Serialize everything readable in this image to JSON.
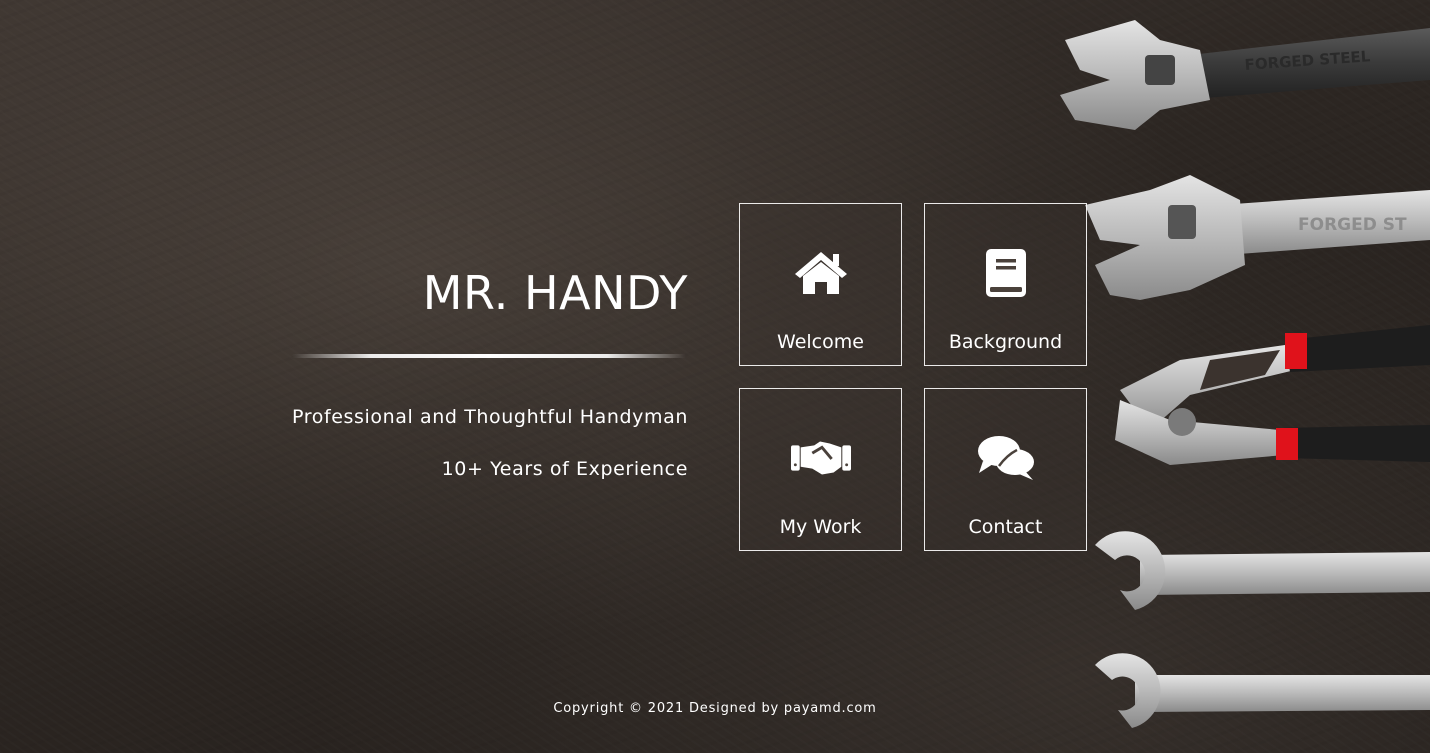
{
  "brand": {
    "title": "MR. HANDY",
    "tagline_1": "Professional and Thoughtful Handyman",
    "tagline_2": "10+ Years of Experience"
  },
  "nav": {
    "tiles": [
      {
        "label": "Welcome",
        "icon": "home-icon"
      },
      {
        "label": "Background",
        "icon": "book-icon"
      },
      {
        "label": "My Work",
        "icon": "handshake-icon"
      },
      {
        "label": "Contact",
        "icon": "comments-icon"
      }
    ]
  },
  "footer": {
    "copyright": "Copyright © 2021 Designed by payamd.com"
  },
  "background_image": {
    "engraving_top": "FORGED STEEL",
    "engraving_second": "FORGED ST"
  },
  "colors": {
    "text": "#ffffff",
    "background": "#2c2622",
    "plier_grip_accent": "#e0121b"
  }
}
